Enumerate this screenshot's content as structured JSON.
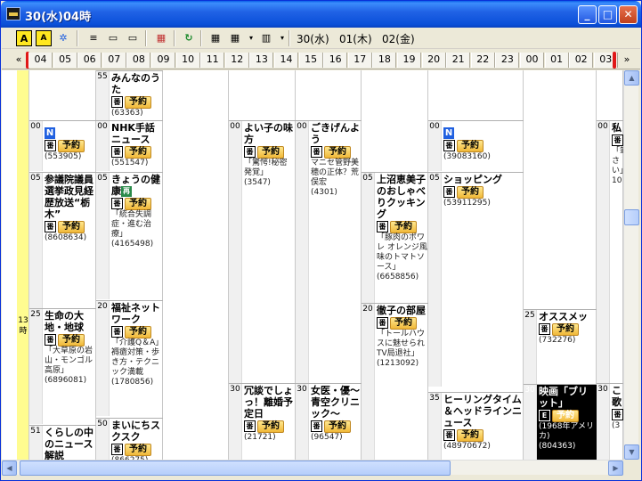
{
  "window": {
    "title": "30(水)04時"
  },
  "titlebar_buttons": {
    "minimize": "_",
    "maximize": "□",
    "close": "✕"
  },
  "toolbar": {
    "icons": [
      "A",
      "A",
      "✲",
      "≡",
      "▭",
      "▭",
      "▦",
      "↻",
      "▦",
      "▦",
      "▥"
    ],
    "dates": [
      "30(水)",
      "01(木)",
      "02(金)"
    ]
  },
  "hours": [
    "04",
    "05",
    "06",
    "07",
    "08",
    "09",
    "10",
    "11",
    "12",
    "13",
    "14",
    "15",
    "16",
    "17",
    "18",
    "19",
    "20",
    "21",
    "22",
    "23",
    "00",
    "01",
    "02",
    "03"
  ],
  "hour_nav": {
    "left": "«",
    "right": "»"
  },
  "timecol": {
    "hour": "13",
    "unit": "時"
  },
  "labels": {
    "reserve": "予約",
    "ban": "番",
    "n": "N",
    "sai": "再",
    "e": "E"
  },
  "programs": [
    {
      "col": 1,
      "min": "55",
      "title": "みんなのうた",
      "desc": "",
      "pid": "(63363)"
    },
    {
      "col": 1,
      "min": "00",
      "title": "NHK手話ニュース",
      "desc": "",
      "pid": "(551547)"
    },
    {
      "col": 1,
      "min": "05",
      "title": "きょうの健康",
      "desc": "「統合失調症・進む治療」",
      "pid": "(4165498)"
    },
    {
      "col": 1,
      "min": "20",
      "title": "福祉ネットワーク",
      "desc": "「介護Q＆A」褥瘡対策・歩き方・テクニック満載",
      "pid": "(1780856)"
    },
    {
      "col": 1,
      "min": "50",
      "title": "まいにちスクスク",
      "desc": "",
      "pid": "(866275)"
    },
    {
      "col": 0,
      "min": "00",
      "title": "",
      "desc": "",
      "pid": "(553905)"
    },
    {
      "col": 0,
      "min": "05",
      "title": "参議院議員選挙政見経歴放送“栃木”",
      "desc": "",
      "pid": "(8608634)"
    },
    {
      "col": 0,
      "min": "25",
      "title": "生命の大地・地球",
      "desc": "「大草原の岩山・モンゴル高原」",
      "pid": "(6896081)"
    },
    {
      "col": 0,
      "min": "51",
      "title": "くらしの中のニュース解説",
      "desc": "",
      "pid": ""
    },
    {
      "col": 3,
      "min": "00",
      "title": "よい子の味方",
      "desc": "「驚愕!秘密発覚」",
      "pid": "(3547)"
    },
    {
      "col": 3,
      "min": "30",
      "title": "冗談でしょっ！離婚予定日",
      "desc": "",
      "pid": "(21721)"
    },
    {
      "col": 4,
      "min": "00",
      "title": "ごきげんよう",
      "desc": "マニセ管野美穂の正体？荒俣宏",
      "pid": "(4301)"
    },
    {
      "col": 4,
      "min": "30",
      "title": "女医・優～青空クリニック～",
      "desc": "",
      "pid": "(96547)"
    },
    {
      "col": 5,
      "min": "05",
      "title": "上沼恵美子のおしゃべりクッキング",
      "desc": "「豚肉のポワレ オレンジ風味のトマトソース」",
      "pid": "(6658856)"
    },
    {
      "col": 5,
      "min": "20",
      "title": "徹子の部屋",
      "desc": "「トールハウスに魅せられTV局退社」",
      "pid": "(1213092)"
    },
    {
      "col": 6,
      "min": "00",
      "title": "",
      "desc": "",
      "pid": "(39083160)"
    },
    {
      "col": 6,
      "min": "05",
      "title": "ショッピング",
      "desc": "",
      "pid": "(53911295)"
    },
    {
      "col": 6,
      "min": "35",
      "title": "ヒーリングタイム＆ヘッドラインニュース",
      "desc": "",
      "pid": "(48970672)"
    },
    {
      "col": 7,
      "min": "25",
      "title": "オススメッ",
      "desc": "",
      "pid": "(732276)"
    },
    {
      "col": 7,
      "min": "30",
      "title": "映画「ブリット」",
      "desc": "(1968年アメリカ)",
      "pid": "(804363)"
    },
    {
      "col": 8,
      "min": "00",
      "title": "私",
      "desc": "「筆さい」",
      "pid": "10"
    },
    {
      "col": 8,
      "min": "30",
      "title": "こ歌",
      "desc": "",
      "pid": "(3"
    }
  ]
}
